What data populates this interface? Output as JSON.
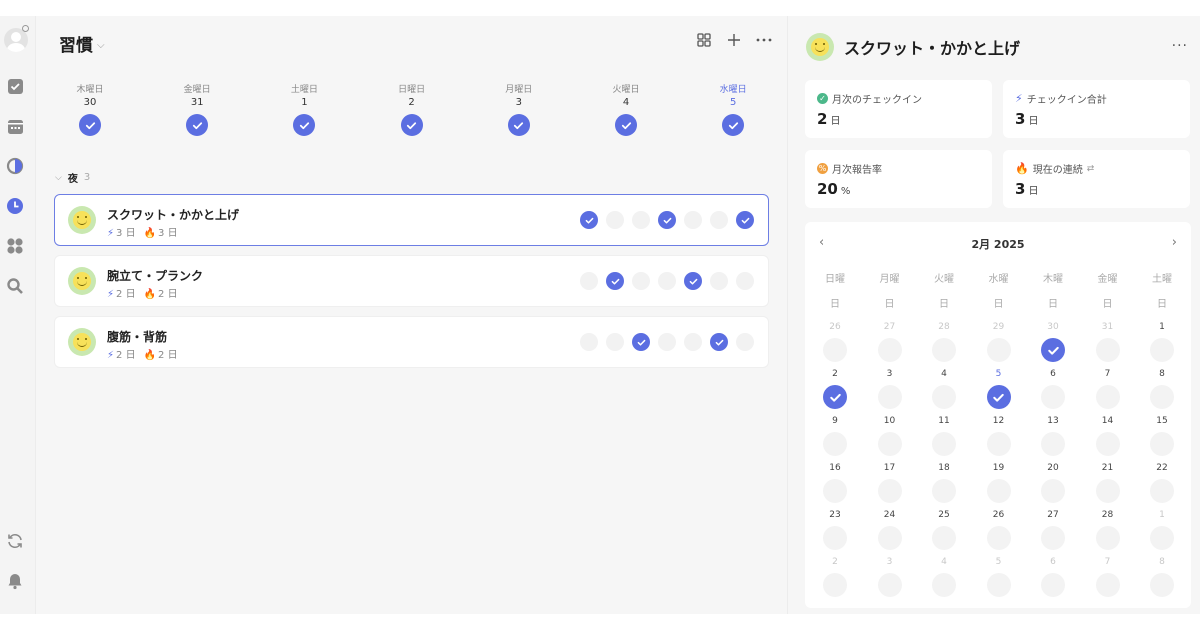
{
  "app": {
    "title": "習慣"
  },
  "week": [
    {
      "name": "木曜日",
      "num": "30",
      "checked": true,
      "today": false
    },
    {
      "name": "金曜日",
      "num": "31",
      "checked": true,
      "today": false
    },
    {
      "name": "土曜日",
      "num": "1",
      "checked": true,
      "today": false
    },
    {
      "name": "日曜日",
      "num": "2",
      "checked": true,
      "today": false
    },
    {
      "name": "月曜日",
      "num": "3",
      "checked": true,
      "today": false
    },
    {
      "name": "火曜日",
      "num": "4",
      "checked": true,
      "today": false
    },
    {
      "name": "水曜日",
      "num": "5",
      "checked": true,
      "today": true
    }
  ],
  "section": {
    "name": "夜",
    "count": "3"
  },
  "habits": [
    {
      "name": "スクワット・かかと上げ",
      "total": "3 日",
      "streak": "3 日",
      "days": [
        true,
        false,
        false,
        true,
        false,
        false,
        true
      ]
    },
    {
      "name": "腕立て・プランク",
      "total": "2 日",
      "streak": "2 日",
      "days": [
        false,
        true,
        false,
        false,
        true,
        false,
        false
      ]
    },
    {
      "name": "腹筋・背筋",
      "total": "2 日",
      "streak": "2 日",
      "days": [
        false,
        false,
        true,
        false,
        false,
        true,
        false
      ]
    }
  ],
  "panel": {
    "title": "スクワット・かかと上げ",
    "stats": {
      "monthly_checkin": {
        "label": "月次のチェックイン",
        "value": "2",
        "unit": "日"
      },
      "total_checkin": {
        "label": "チェックイン合計",
        "value": "3",
        "unit": "日"
      },
      "monthly_rate": {
        "label": "月次報告率",
        "value": "20",
        "unit": "%"
      },
      "current_streak": {
        "label": "現在の連続",
        "value": "3",
        "unit": "日"
      }
    },
    "calendar": {
      "month": "2月 2025",
      "weekdays": [
        "日曜",
        "月曜",
        "火曜",
        "水曜",
        "木曜",
        "金曜",
        "土曜"
      ],
      "weekdays_sub": [
        "日",
        "日",
        "日",
        "日",
        "日",
        "日",
        "日"
      ],
      "days": [
        {
          "d": "26",
          "other": true
        },
        {
          "d": "27",
          "other": true
        },
        {
          "d": "28",
          "other": true
        },
        {
          "d": "29",
          "other": true
        },
        {
          "d": "30",
          "other": true,
          "on": true
        },
        {
          "d": "31",
          "other": true
        },
        {
          "d": "1"
        },
        {
          "d": "2",
          "on": true
        },
        {
          "d": "3"
        },
        {
          "d": "4"
        },
        {
          "d": "5",
          "on": true,
          "today": true
        },
        {
          "d": "6"
        },
        {
          "d": "7"
        },
        {
          "d": "8"
        },
        {
          "d": "9"
        },
        {
          "d": "10"
        },
        {
          "d": "11"
        },
        {
          "d": "12"
        },
        {
          "d": "13"
        },
        {
          "d": "14"
        },
        {
          "d": "15"
        },
        {
          "d": "16"
        },
        {
          "d": "17"
        },
        {
          "d": "18"
        },
        {
          "d": "19"
        },
        {
          "d": "20"
        },
        {
          "d": "21"
        },
        {
          "d": "22"
        },
        {
          "d": "23"
        },
        {
          "d": "24"
        },
        {
          "d": "25"
        },
        {
          "d": "26"
        },
        {
          "d": "27"
        },
        {
          "d": "28"
        },
        {
          "d": "1",
          "other": true
        },
        {
          "d": "2",
          "other": true
        },
        {
          "d": "3",
          "other": true
        },
        {
          "d": "4",
          "other": true
        },
        {
          "d": "5",
          "other": true
        },
        {
          "d": "6",
          "other": true
        },
        {
          "d": "7",
          "other": true
        },
        {
          "d": "8",
          "other": true
        }
      ]
    }
  },
  "colors": {
    "accent": "#5b6ee1",
    "streak": "#f07050",
    "rate": "#f0a040",
    "checkin": "#4cb88a"
  }
}
